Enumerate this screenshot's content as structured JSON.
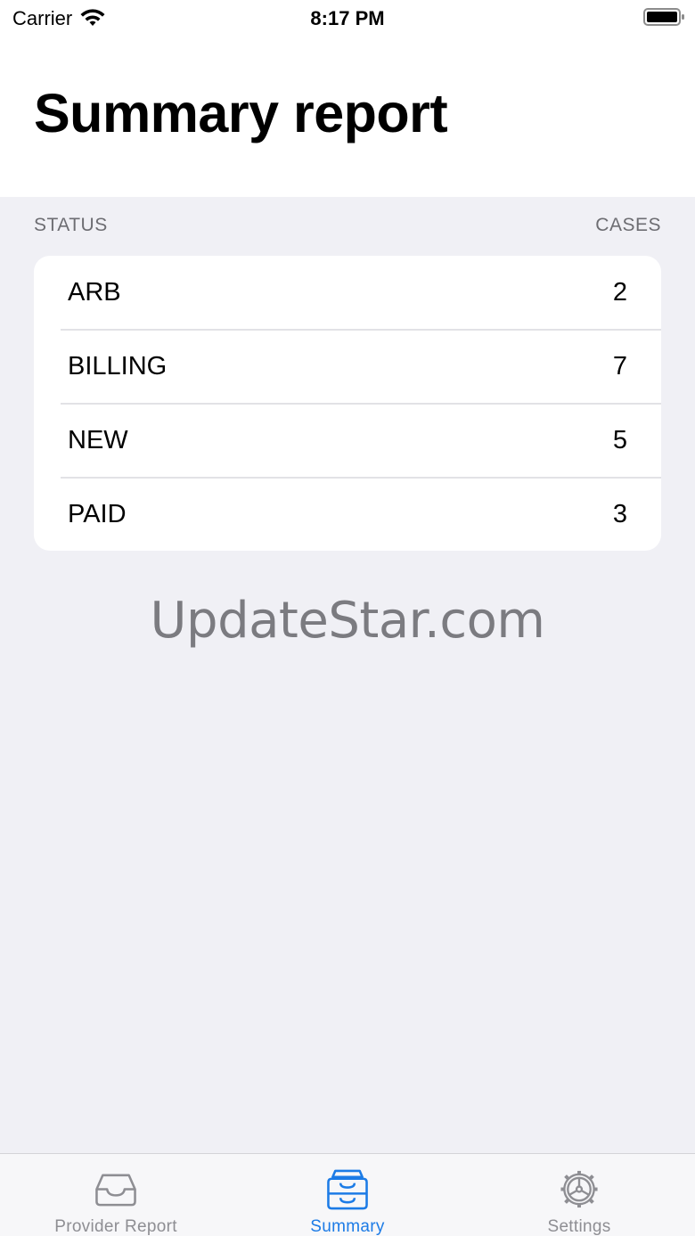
{
  "status_bar": {
    "carrier": "Carrier",
    "time": "8:17 PM"
  },
  "header": {
    "title": "Summary report"
  },
  "section": {
    "left_header": "STATUS",
    "right_header": "CASES"
  },
  "rows": [
    {
      "label": "ARB",
      "count": "2"
    },
    {
      "label": "BILLING",
      "count": "7"
    },
    {
      "label": "NEW",
      "count": "5"
    },
    {
      "label": "PAID",
      "count": "3"
    }
  ],
  "watermark": "UpdateStar.com",
  "tabs": [
    {
      "label": "Provider Report",
      "icon": "tray-icon",
      "active": false
    },
    {
      "label": "Summary",
      "icon": "tray-full-icon",
      "active": true
    },
    {
      "label": "Settings",
      "icon": "gear-icon",
      "active": false
    }
  ],
  "colors": {
    "accent": "#1c7be6",
    "inactive": "#8e8e93",
    "background": "#f0f0f5"
  }
}
